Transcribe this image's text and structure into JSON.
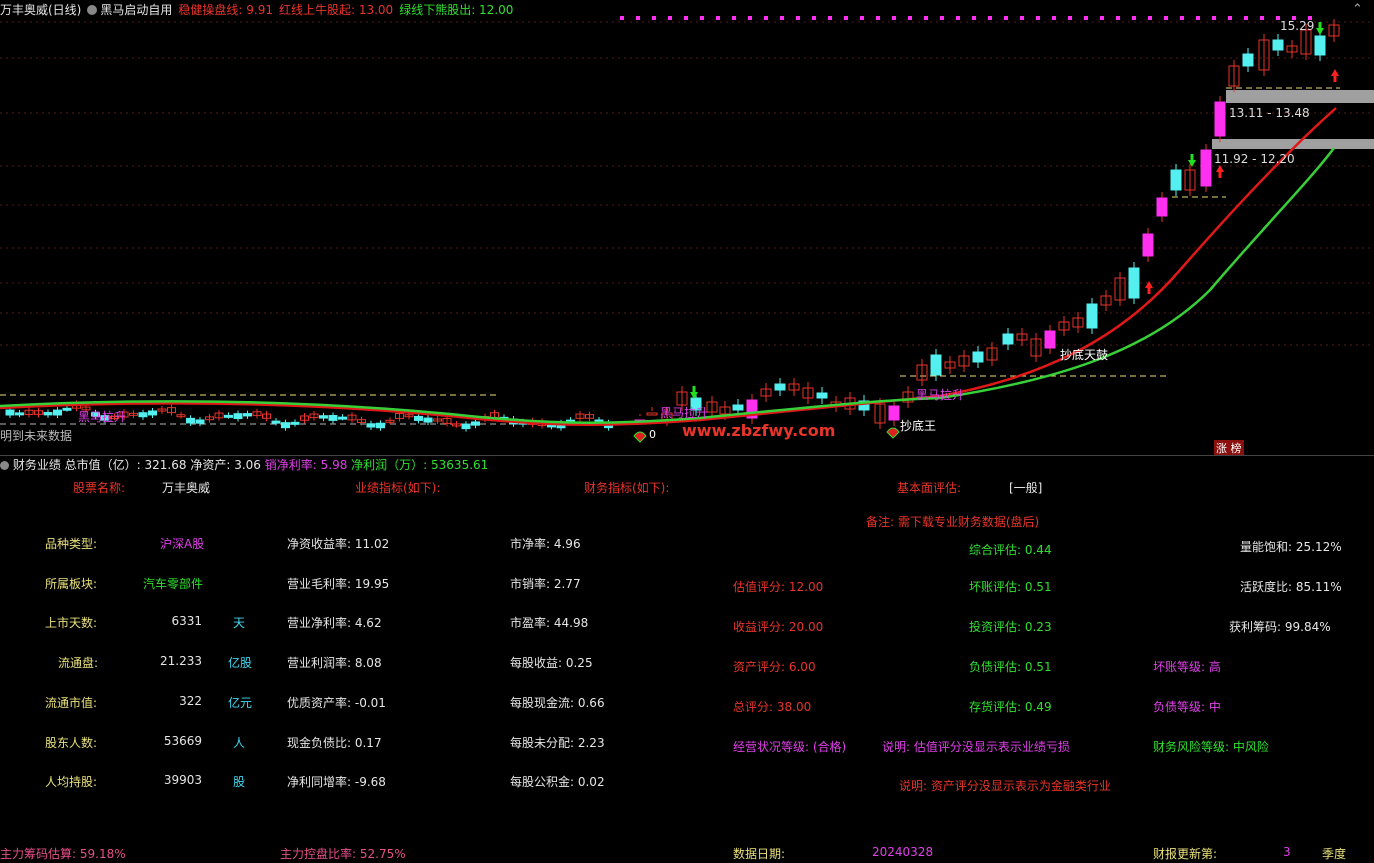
{
  "chart_header": {
    "stock_name": "万丰奥威(日线)",
    "indicator_name": "黑马启动自用",
    "line1": "稳健操盘线: 9.91",
    "line2": "红线上牛股起: 13.00",
    "line3": "绿线下熊股出: 12.00"
  },
  "chart_annotations": {
    "high_price": "15.29",
    "zone_upper": "13.11 - 13.48",
    "zone_lower": "11.92 - 12.20",
    "heima_lasheng": "黑马拉升",
    "chaodi_wang": "抄底王",
    "chaodi_tianyi": "抄底天鼓",
    "future_note": "明到未来数据",
    "zhangting": "涨 榜",
    "watermark": "www.zbzfwy.com",
    "zero_mark": "0"
  },
  "colors": {
    "up": "#e8342a",
    "down": "#54f0f0",
    "signal": "#ff30f0",
    "red_line": "#e01818",
    "green_line": "#38d038",
    "zone_bar": "#a0a0a0"
  },
  "finance_bar": {
    "title": "财务业绩",
    "total_value": "总市值（亿）: 321.68",
    "net_assets": "净资产: 3.06",
    "net_margin": "销净利率: 5.98",
    "net_profit": "净利润（万）: 53635.61"
  },
  "panel": {
    "stock_name_label": "股票名称:",
    "stock_name_value": "万丰奥威",
    "perf_label": "业绩指标(如下):",
    "fin_label": "财务指标(如下):",
    "fund_label": "基本面评估:",
    "fund_value": "[一般]",
    "note": "备注: 需下载专业财务数据(盘后)",
    "col1": [
      {
        "label": "品种类型:",
        "value": "沪深A股",
        "unit": ""
      },
      {
        "label": "所属板块:",
        "value": "汽车零部件",
        "unit": ""
      },
      {
        "label": "上市天数:",
        "value": "6331",
        "unit": "天"
      },
      {
        "label": "流通盘:",
        "value": "21.233",
        "unit": "亿股"
      },
      {
        "label": "流通市值:",
        "value": "322",
        "unit": "亿元"
      },
      {
        "label": "股东人数:",
        "value": "53669",
        "unit": "人"
      },
      {
        "label": "人均持股:",
        "value": "39903",
        "unit": "股"
      }
    ],
    "col2": [
      "净资收益率: 11.02",
      "营业毛利率: 19.95",
      "营业净利率: 4.62",
      "营业利润率: 8.08",
      "优质资产率: -0.01",
      "现金负债比: 0.17",
      "净利同增率: -9.68"
    ],
    "col3": [
      "市净率: 4.96",
      "市销率: 2.77",
      "市盈率: 44.98",
      "每股收益: 0.25",
      "每股现金流: 0.66",
      "每股未分配: 2.23",
      "每股公积金: 0.02"
    ],
    "scores": [
      "估值评分: 12.00",
      "收益评分: 20.00",
      "资产评分: 6.00",
      "总评分: 38.00"
    ],
    "evals": [
      "综合评估: 0.44",
      "坏账评估: 0.51",
      "投资评估: 0.23",
      "负债评估: 0.51",
      "存货评估: 0.49"
    ],
    "right": [
      "量能饱和:  25.12%",
      "活跃度比:  85.11%",
      "获利筹码:  99.84%"
    ],
    "bad_debt_level": "坏账等级: 高",
    "debt_level": "负债等级: 中",
    "biz_level": "经营状况等级: (合格)",
    "note2": "说明: 估值评分没显示表示业绩亏损",
    "risk_level": "财务风险等级: 中风险",
    "note3": "说明: 资产评分没显示表示为金融类行业"
  },
  "bottom": {
    "chip_est": "主力筹码估算:  59.18%",
    "control_ratio": "主力控盘比率:  52.75%",
    "data_date_label": "数据日期:",
    "data_date": "20240328",
    "report_label": "财报更新第:",
    "report_num": "3",
    "report_unit": "季度"
  }
}
